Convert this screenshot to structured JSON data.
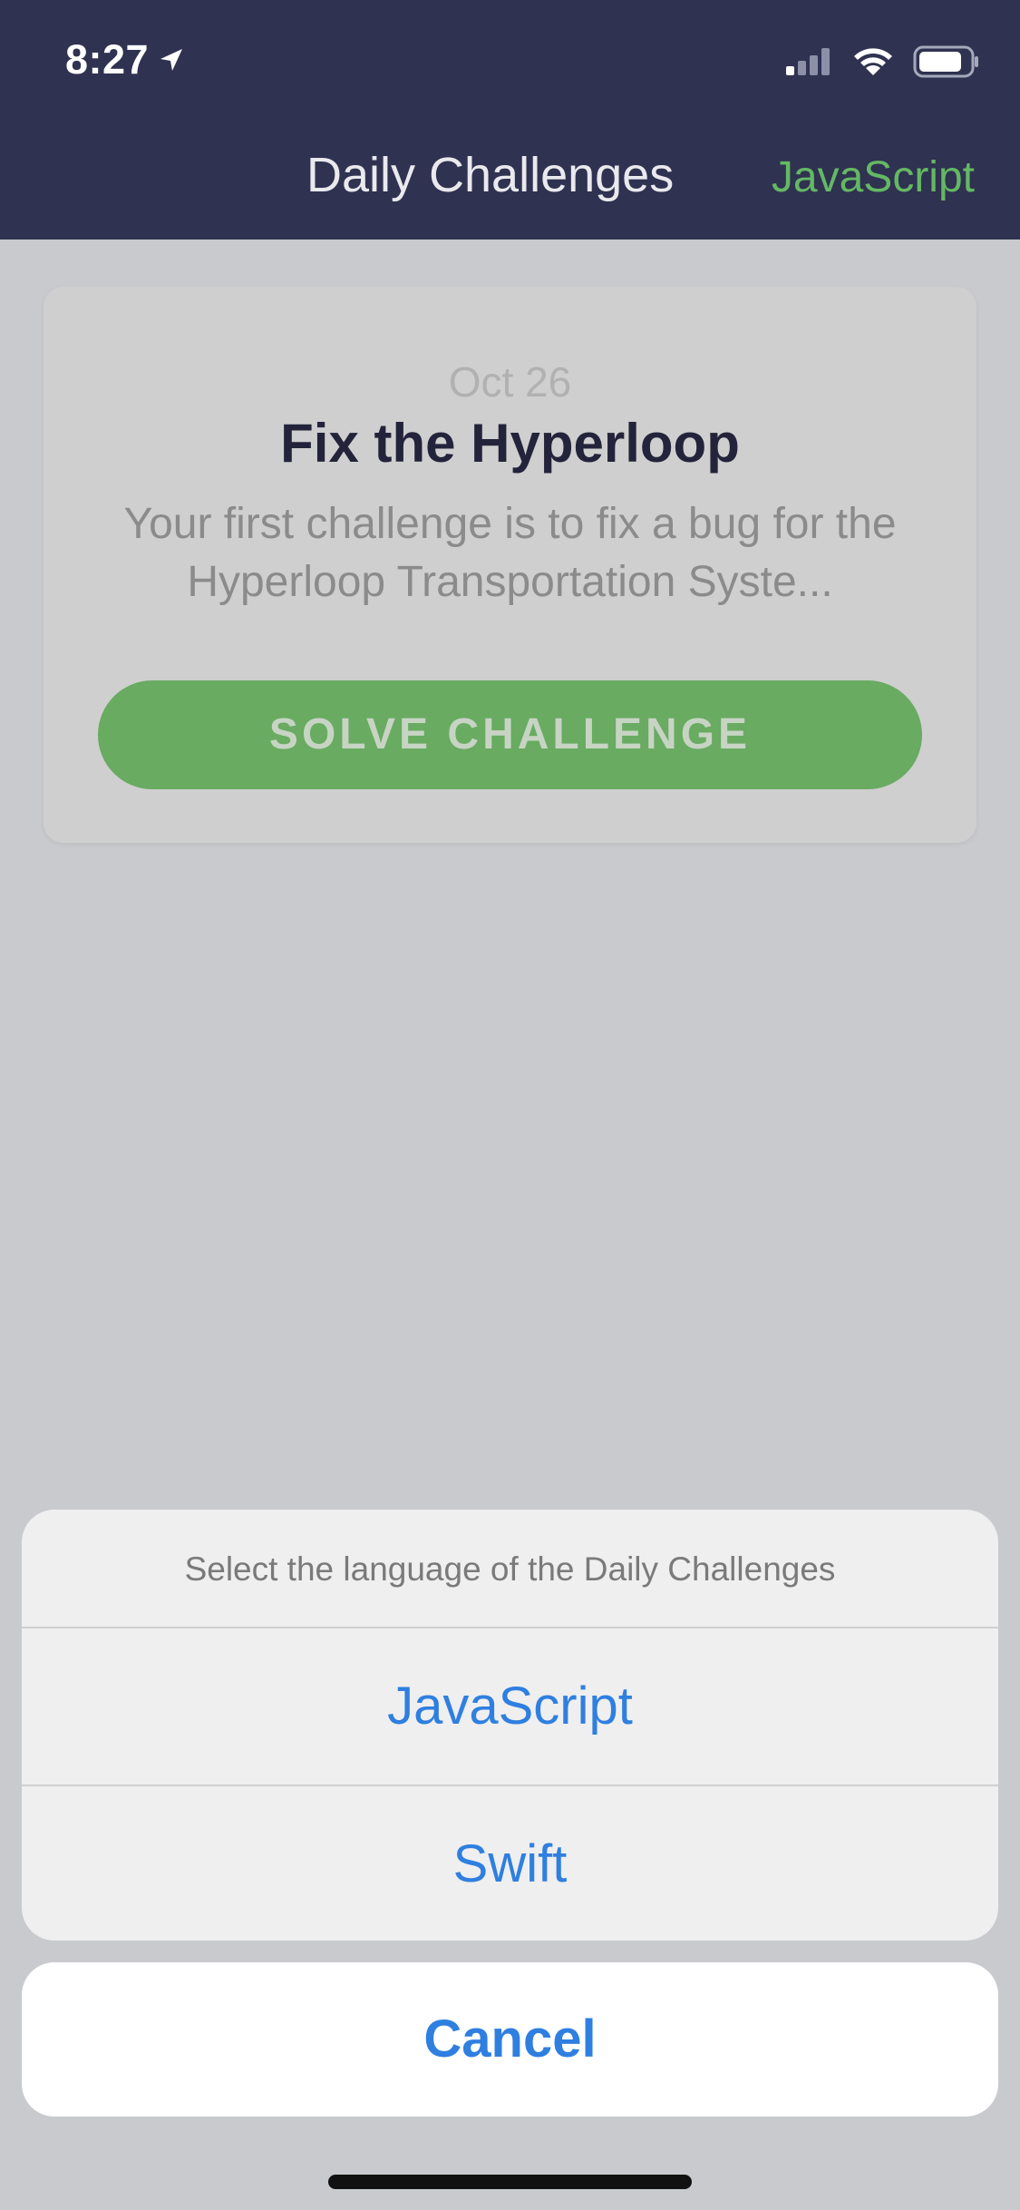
{
  "status": {
    "time": "8:27"
  },
  "header": {
    "title": "Daily Challenges",
    "language": "JavaScript"
  },
  "card": {
    "date": "Oct 26",
    "title": "Fix the Hyperloop",
    "description": "Your first challenge is to fix a bug for the Hyperloop Transportation Syste...",
    "button_label": "SOLVE CHALLENGE"
  },
  "action_sheet": {
    "title": "Select the language of the Daily Challenges",
    "options": [
      "JavaScript",
      "Swift"
    ],
    "cancel_label": "Cancel"
  },
  "colors": {
    "header_bg": "#2f3250",
    "accent_green": "#64b864",
    "action_blue": "#2f7fe0"
  },
  "icons": {
    "location": "location-arrow-icon",
    "signal": "cellular-signal-icon",
    "wifi": "wifi-icon",
    "battery": "battery-icon"
  }
}
